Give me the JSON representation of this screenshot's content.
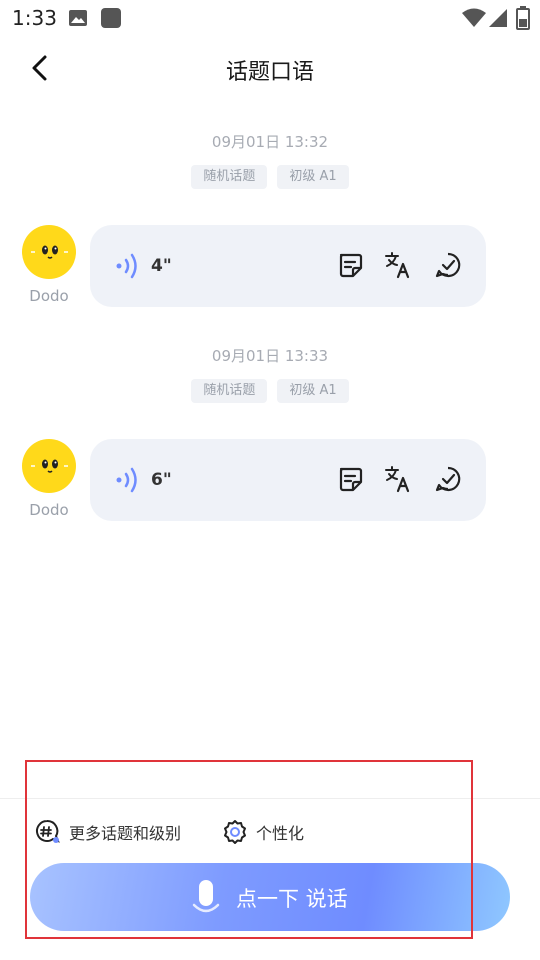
{
  "status_bar": {
    "time": "1:33",
    "icons": [
      "gallery-icon",
      "app-square-icon",
      "wifi-icon",
      "signal-icon",
      "battery-icon"
    ]
  },
  "header": {
    "title": "话题口语",
    "back_icon": "chevron-left-icon"
  },
  "messages": [
    {
      "timestamp": "09月01日 13:32",
      "tags": [
        "随机话题",
        "初级 A1"
      ],
      "avatar_name": "Dodo",
      "duration": "4\"",
      "actions": [
        "note-icon",
        "translate-icon",
        "check-bubble-icon"
      ]
    },
    {
      "timestamp": "09月01日 13:33",
      "tags": [
        "随机话题",
        "初级 A1"
      ],
      "avatar_name": "Dodo",
      "duration": "6\"",
      "actions": [
        "note-icon",
        "translate-icon",
        "check-bubble-icon"
      ]
    }
  ],
  "bottom": {
    "more_topics_label": "更多话题和级别",
    "personalize_label": "个性化",
    "talk_button_label": "点一下 说话"
  },
  "colors": {
    "accent": "#6f8cff",
    "bubble_bg": "#eff2f8",
    "avatar": "#ffd91a",
    "highlight": "#e0343a"
  }
}
